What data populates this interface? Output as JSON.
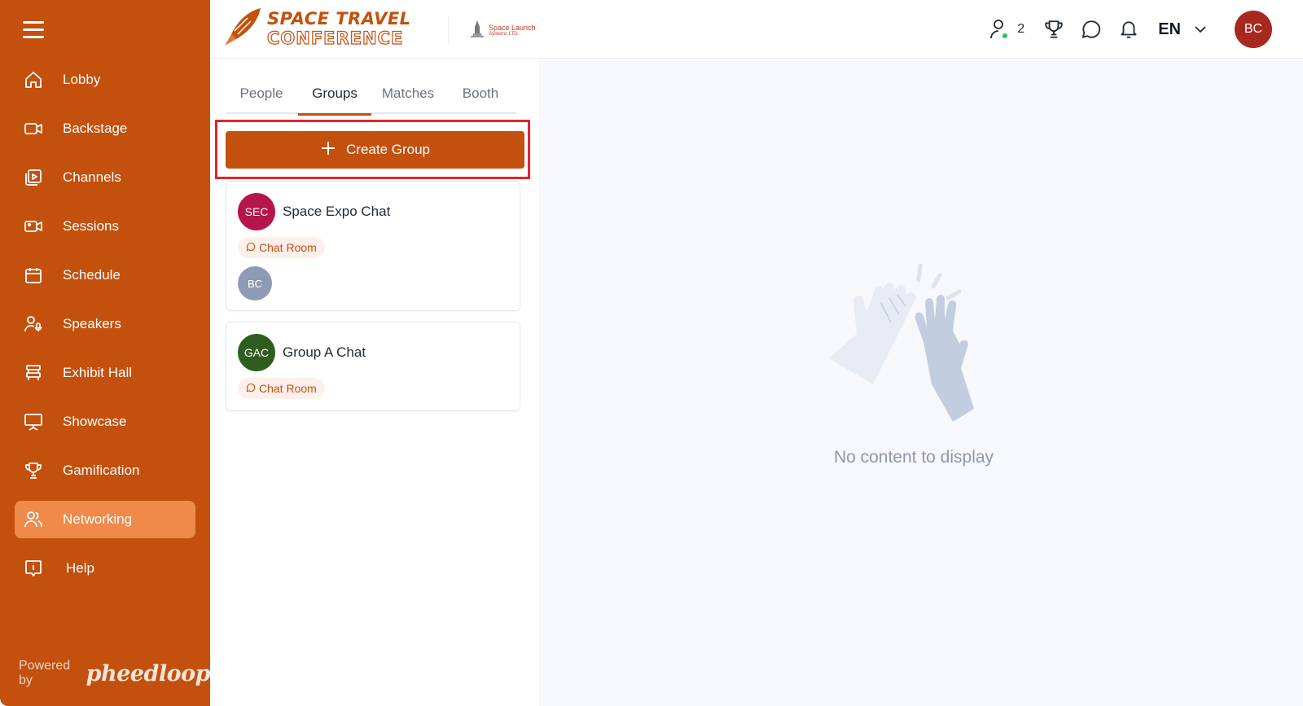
{
  "sidebar": {
    "menu_icon": "hamburger-icon",
    "items": [
      {
        "label": "Lobby",
        "icon": "home-icon",
        "active": false
      },
      {
        "label": "Backstage",
        "icon": "video-camera-icon",
        "active": false
      },
      {
        "label": "Channels",
        "icon": "play-library-icon",
        "active": false
      },
      {
        "label": "Sessions",
        "icon": "video-camera-icon",
        "active": false
      },
      {
        "label": "Schedule",
        "icon": "calendar-icon",
        "active": false
      },
      {
        "label": "Speakers",
        "icon": "speaker-mic-icon",
        "active": false
      },
      {
        "label": "Exhibit Hall",
        "icon": "booth-icon",
        "active": false
      },
      {
        "label": "Showcase",
        "icon": "presentation-icon",
        "active": false
      },
      {
        "label": "Gamification",
        "icon": "trophy-icon",
        "active": false
      },
      {
        "label": "Networking",
        "icon": "people-icon",
        "active": true
      },
      {
        "label": "Help",
        "icon": "info-chat-icon",
        "active": false
      }
    ],
    "powered_by_label": "Powered by",
    "powered_by_brand": "pheedloop"
  },
  "header": {
    "brand_line1": "SPACE TRAVEL",
    "brand_line2": "CONFERENCE",
    "sponsor_name": "Space Launch",
    "sponsor_sub": "Systems LTD.",
    "online_count": "2",
    "language": "EN",
    "user_initials": "BC"
  },
  "networking": {
    "tabs": [
      {
        "label": "People",
        "active": false
      },
      {
        "label": "Groups",
        "active": true
      },
      {
        "label": "Matches",
        "active": false
      },
      {
        "label": "Booth",
        "active": false
      }
    ],
    "create_button_label": "Create Group",
    "groups": [
      {
        "initials": "SEC",
        "name": "Space Expo Chat",
        "tag": "Chat Room",
        "members": [
          "BC"
        ],
        "color": "#b5154b"
      },
      {
        "initials": "GAC",
        "name": "Group A Chat",
        "tag": "Chat Room",
        "members": [],
        "color": "#2f5d1f"
      }
    ]
  },
  "empty_state": {
    "message": "No content to display",
    "icon": "high-five-icon"
  },
  "colors": {
    "brand": "#c4500d",
    "active_nav": "#f08a4b",
    "highlight": "#e4232b",
    "avatar": "#a8281f"
  }
}
